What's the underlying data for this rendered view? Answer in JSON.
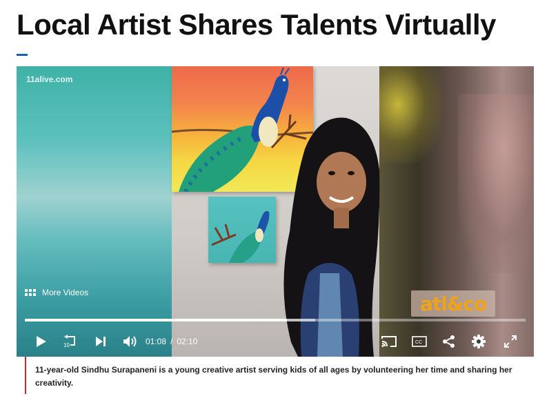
{
  "article": {
    "headline": "Local Artist Shares Talents Virtually",
    "caption": "11-year-old Sindhu Surapaneni is a young creative artist serving kids of all ages by volunteering her time and sharing her creativity."
  },
  "video": {
    "watermark": "11alive.com",
    "more_videos_label": "More Videos",
    "brand_logo_text": "atl&co",
    "current_time": "01:08",
    "time_separator": "/",
    "duration": "02:10",
    "played_fraction": 0.523,
    "buffered_fraction": 0.58
  },
  "controls": {
    "icons": [
      "play-icon",
      "rewind-10-icon",
      "skip-next-icon",
      "volume-icon",
      "cast-icon",
      "closed-captions-icon",
      "share-icon",
      "settings-icon",
      "fullscreen-icon"
    ],
    "rewind_seconds": "10",
    "cc_label": "CC"
  },
  "colors": {
    "accent_blue": "#1a5fb4",
    "caption_rule_red": "#d61d2a",
    "brand_orange": "#f0a218"
  }
}
